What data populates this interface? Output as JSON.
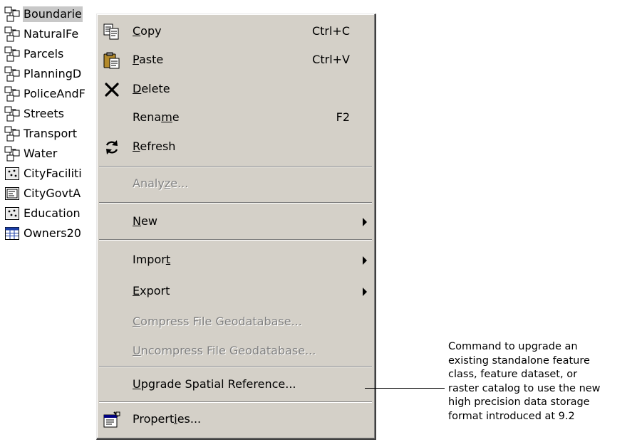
{
  "tree": {
    "items": [
      {
        "label": "Boundarie",
        "icon": "feature-dataset-icon",
        "selected": true
      },
      {
        "label": "NaturalFe",
        "icon": "feature-dataset-icon"
      },
      {
        "label": "Parcels",
        "icon": "feature-dataset-icon"
      },
      {
        "label": "PlanningD",
        "icon": "feature-dataset-icon"
      },
      {
        "label": "PoliceAndF",
        "icon": "feature-dataset-icon"
      },
      {
        "label": "Streets",
        "icon": "feature-dataset-icon"
      },
      {
        "label": "Transport",
        "icon": "feature-dataset-icon"
      },
      {
        "label": "Water",
        "icon": "feature-dataset-icon"
      },
      {
        "label": "CityFaciliti",
        "icon": "point-feature-class-icon"
      },
      {
        "label": "CityGovtA",
        "icon": "annotation-feature-class-icon"
      },
      {
        "label": "Education",
        "icon": "point-feature-class-icon"
      },
      {
        "label": "Owners20",
        "icon": "table-icon"
      }
    ]
  },
  "menu": {
    "items": [
      {
        "id": "copy",
        "label": "Copy",
        "mnemonic": "C",
        "shortcut": "Ctrl+C",
        "icon": "copy-icon"
      },
      {
        "id": "paste",
        "label": "Paste",
        "mnemonic": "P",
        "shortcut": "Ctrl+V",
        "icon": "paste-icon"
      },
      {
        "id": "delete",
        "label": "Delete",
        "mnemonic": "D",
        "icon": "delete-icon"
      },
      {
        "id": "rename",
        "label": "Rename",
        "mnemonic": "m",
        "shortcut": "F2"
      },
      {
        "id": "refresh",
        "label": "Refresh",
        "mnemonic": "R",
        "icon": "refresh-icon"
      },
      {
        "separator": true
      },
      {
        "id": "analyze",
        "label": "Analyze...",
        "mnemonic": "z",
        "disabled": true
      },
      {
        "separator": true
      },
      {
        "id": "new",
        "label": "New",
        "mnemonic": "N",
        "submenu": true
      },
      {
        "separator": true
      },
      {
        "id": "import",
        "label": "Import",
        "mnemonic": "t",
        "submenu": true
      },
      {
        "id": "export",
        "label": "Export",
        "mnemonic": "E",
        "submenu": true
      },
      {
        "id": "compress",
        "label": "Compress File Geodatabase...",
        "mnemonic": "C",
        "disabled": true
      },
      {
        "id": "uncompress",
        "label": "Uncompress File Geodatabase...",
        "mnemonic": "U",
        "disabled": true
      },
      {
        "separator": true
      },
      {
        "id": "upgrade-spatial-reference",
        "label": "Upgrade Spatial Reference...",
        "mnemonic": "U"
      },
      {
        "separator": true
      },
      {
        "id": "properties",
        "label": "Properties...",
        "mnemonic": "i",
        "icon": "properties-icon"
      }
    ]
  },
  "callout": {
    "lines": [
      "Command to upgrade an",
      "existing standalone feature",
      "class, feature dataset, or",
      "raster catalog to use the new",
      "high precision data storage",
      "format introduced at 9.2"
    ]
  },
  "colors": {
    "menu_bg": "#d4d0c8",
    "disabled_text": "#808080",
    "selection": "#c8c8c8"
  }
}
